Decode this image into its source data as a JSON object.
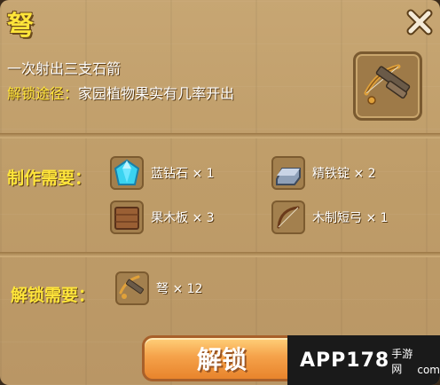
{
  "item": {
    "title": "弩",
    "description": "一次射出三支石箭",
    "unlock_route_label": "解锁途径：",
    "unlock_route_value": "家园植物果实有几率开出",
    "icon": "crossbow-icon"
  },
  "crafting": {
    "label": "制作需要：",
    "materials": [
      {
        "name": "蓝钻石",
        "qty": "× 1",
        "icon": "blue-diamond-icon"
      },
      {
        "name": "精铁锭",
        "qty": "× 2",
        "icon": "iron-ingot-icon"
      },
      {
        "name": "果木板",
        "qty": "× 3",
        "icon": "wood-plank-icon"
      },
      {
        "name": "木制短弓",
        "qty": "× 1",
        "icon": "short-bow-icon"
      }
    ]
  },
  "unlock": {
    "label": "解锁需要：",
    "requirement": {
      "name": "弩",
      "qty": "× 12",
      "icon": "crossbow-fragment-icon"
    }
  },
  "actions": {
    "unlock_button": "解锁",
    "close_icon": "close-icon"
  },
  "watermark": {
    "logo": "APP178",
    "sub": "手游网",
    "domain": "com"
  },
  "colors": {
    "title_yellow": "#ffe53a",
    "panel_bg": "#c7a673",
    "button_orange": "#f5a24a"
  }
}
